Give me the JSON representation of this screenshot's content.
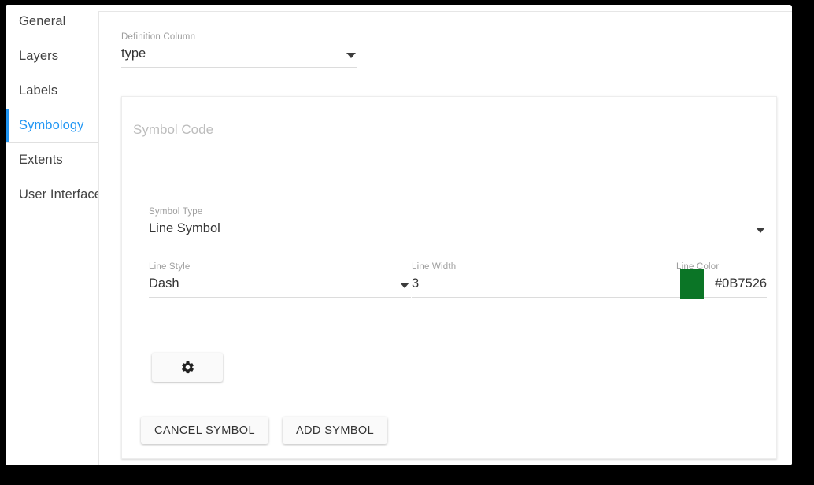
{
  "sidebar": {
    "items": [
      {
        "label": "General",
        "active": false
      },
      {
        "label": "Layers",
        "active": false
      },
      {
        "label": "Labels",
        "active": false
      },
      {
        "label": "Symbology",
        "active": true
      },
      {
        "label": "Extents",
        "active": false
      },
      {
        "label": "User Interface",
        "active": false
      }
    ],
    "active_accent_color": "#2196F3"
  },
  "main": {
    "definition_column": {
      "label": "Definition Column",
      "value": "type",
      "dropdown_icon": "chevron-down-icon"
    },
    "symbol_panel": {
      "symbol_code": {
        "label": "Symbol Code",
        "placeholder": "Symbol Code",
        "value": ""
      },
      "symbol_type": {
        "label": "Symbol Type",
        "value": "Line Symbol",
        "dropdown_icon": "chevron-down-icon"
      },
      "line_style": {
        "label": "Line Style",
        "value": "Dash",
        "dropdown_icon": "chevron-down-icon"
      },
      "line_width": {
        "label": "Line Width",
        "value": "3"
      },
      "line_color": {
        "label": "Line Color",
        "value": "#0B7526",
        "swatch_color": "#0B7526"
      },
      "settings_button": {
        "icon": "gear-icon"
      },
      "actions": {
        "cancel_label": "CANCEL SYMBOL",
        "add_label": "ADD SYMBOL"
      }
    }
  }
}
